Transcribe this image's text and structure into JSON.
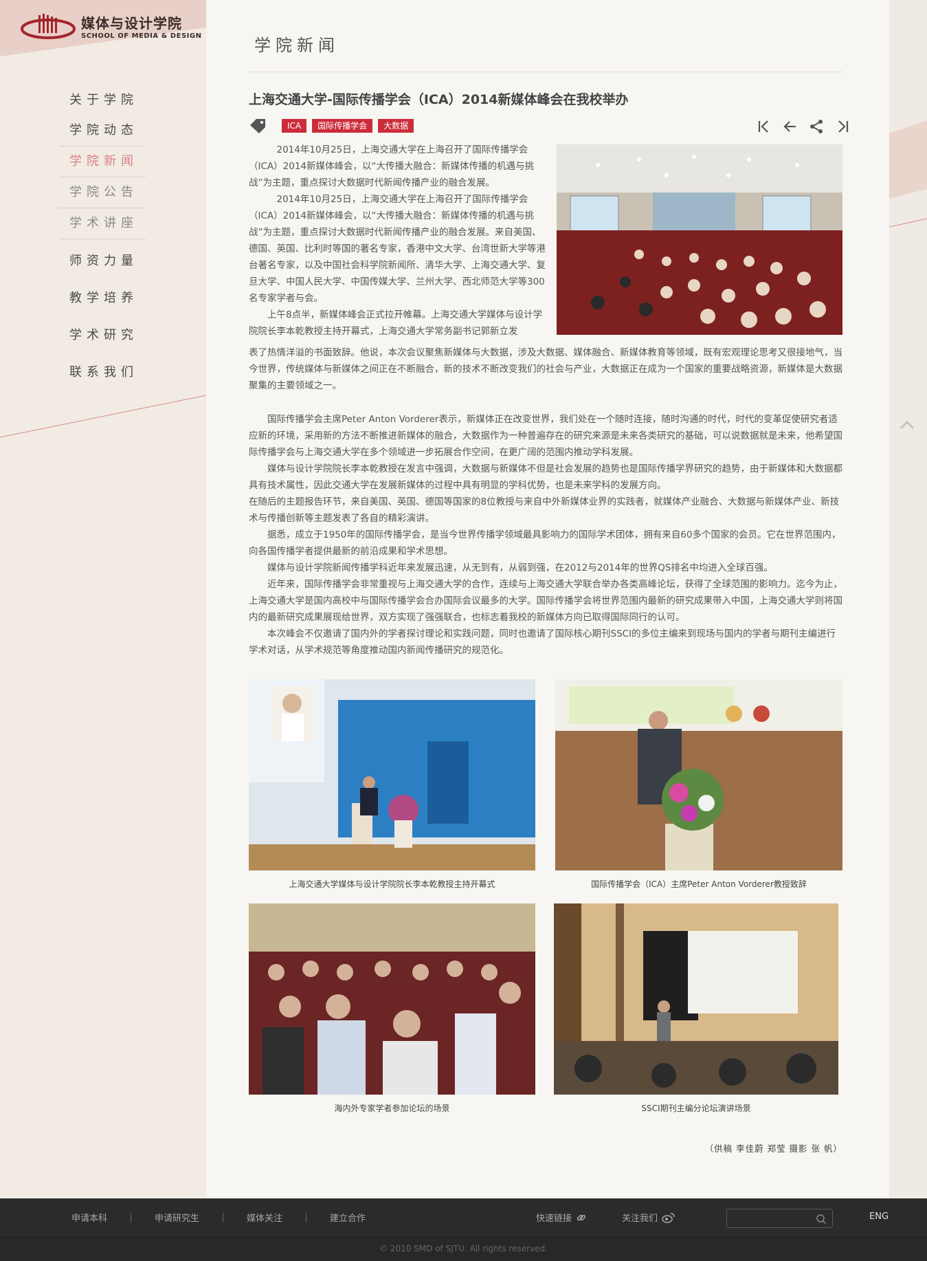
{
  "logo": {
    "name_cn": "媒体与设计学院",
    "name_en": "SCHOOL OF MEDIA & DESIGN"
  },
  "sidebar": {
    "items": [
      {
        "label": "关于学院"
      },
      {
        "label": "学院动态"
      },
      {
        "label": "学院新闻"
      },
      {
        "label": "学院公告"
      },
      {
        "label": "学术讲座"
      },
      {
        "label": "师资力量"
      },
      {
        "label": "教学培养"
      },
      {
        "label": "学术研究"
      },
      {
        "label": "联系我们"
      }
    ]
  },
  "main": {
    "section_title": "学院新闻",
    "article_title": "上海交通大学-国际传播学会（ICA）2014新媒体峰会在我校举办",
    "tags": [
      "ICA",
      "国际传播学会",
      "大数据"
    ],
    "paragraphs": {
      "p1": "2014年10月25日，上海交通大学在上海召开了国际传播学会（ICA）2014新媒体峰会，以“大传播大融合：新媒体传播的机遇与挑战”为主题，重点探讨大数据时代新闻传播产业的融合发展。",
      "p2": "2014年10月25日，上海交通大学在上海召开了国际传播学会（ICA）2014新媒体峰会，以“大传播大融合：新媒体传播的机遇与挑战”为主题，重点探讨大数据时代新闻传播产业的融合发展。来自美国、德国、英国、比利时等国的著名专家，香港中文大学、台湾世新大学等港台著名专家，以及中国社会科学院新闻所、清华大学、上海交通大学、复旦大学、中国人民大学、中国传媒大学、兰州大学、西北师范大学等300名专家学者与会。",
      "p3a": "上午8点半，新媒体峰会正式拉开帷幕。上海交通大学媒体与设计学院院长李本乾教授主持开幕式，上海交通大学常务副书记郭新立发",
      "p3b": "表了热情洋溢的书面致辞。他说，本次会议聚焦新媒体与大数据，涉及大数据、媒体融合、新媒体教育等领域，既有宏观理论思考又很接地气，当今世界，传统媒体与新媒体之间正在不断融合，新的技术不断改变我们的社会与产业，大数据正在成为一个国家的重要战略资源，新媒体是大数据聚集的主要领域之一。",
      "p4": "国际传播学会主席Peter Anton Vorderer表示，新媒体正在改变世界，我们处在一个随时连接，随时沟通的时代，时代的变革促使研究者适应新的环境，采用新的方法不断推进新媒体的融合，大数据作为一种普遍存在的研究来源是未来各类研究的基础，可以说数据就是未来，他希望国际传播学会与上海交通大学在多个领域进一步拓展合作空间，在更广阔的范围内推动学科发展。",
      "p5": "媒体与设计学院院长李本乾教授在发言中强调，大数据与新媒体不但是社会发展的趋势也是国际传播学界研究的趋势，由于新媒体和大数据都具有技术属性，因此交通大学在发展新媒体的过程中具有明显的学科优势，也是未来学科的发展方向。",
      "p6": "在随后的主题报告环节，来自美国、英国、德国等国家的8位教授与来自中外新媒体业界的实践者，就媒体产业融合、大数据与新媒体产业、新技术与传播创新等主题发表了各自的精彩演讲。",
      "p7": "据悉，成立于1950年的国际传播学会，是当今世界传播学领域最具影响力的国际学术团体，拥有来自60多个国家的会员。它在世界范围内，向各国传播学者提供最新的前沿成果和学术思想。",
      "p8": "媒体与设计学院新闻传播学科近年来发展迅速，从无到有，从弱到强，在2012与2014年的世界QS排名中均进入全球百强。",
      "p9": "近年来，国际传播学会非常重视与上海交通大学的合作，连续与上海交通大学联合举办各类高峰论坛，获得了全球范围的影响力。迄今为止，上海交通大学是国内高校中与国际传播学会合办国际会议最多的大学。国际传播学会将世界范围内最新的研究成果带入中国，上海交通大学则将国内的最新研究成果展现给世界，双方实现了强强联合，也标志着我校的新媒体方向已取得国际同行的认可。",
      "p10": "本次峰会不仅邀请了国内外的学者探讨理论和实践问题，同时也邀请了国际核心期刊SSCI的多位主编来到现场与国内的学者与期刊主编进行学术对话，从学术规范等角度推动国内新闻传播研究的规范化。"
    },
    "captions": [
      "上海交通大学媒体与设计学院院长李本乾教授主持开幕式",
      "国际传播学会（ICA）主席Peter Anton Vorderer教授致辞",
      "海内外专家学者参加论坛的场景",
      "SSCI期刊主编分论坛演讲场景"
    ],
    "credit": "（供稿  李佳蔚 郑莹    摄影  张  帆）"
  },
  "footer": {
    "links": [
      "申请本科",
      "申请研究生",
      "媒体关注",
      "建立合作"
    ],
    "quick_links": "快速链接",
    "follow_us": "关注我们",
    "search_placeholder": "",
    "lang": "ENG",
    "copyright": "© 2010 SMD of SJTU. All rights reserved."
  },
  "colors": {
    "accent": "#cc2c3a",
    "nav_active": "#d97f86",
    "footer_bg": "#2b2b2b"
  }
}
